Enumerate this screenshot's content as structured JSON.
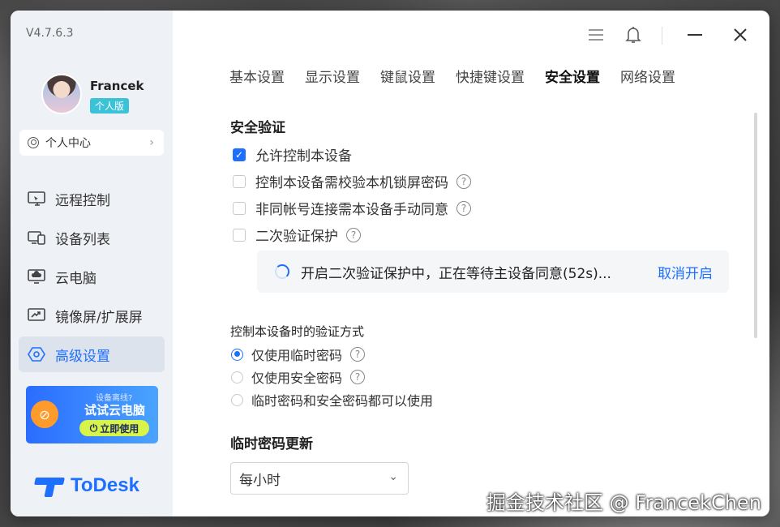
{
  "app": {
    "version": "V4.7.6.3",
    "brand_color": "#1f6fff",
    "logo_text": "ToDesk"
  },
  "user": {
    "name": "Francek",
    "edition": "个人版",
    "center_label": "个人中心"
  },
  "sidebar": {
    "items": [
      {
        "label": "远程控制",
        "icon": "remote-control-icon"
      },
      {
        "label": "设备列表",
        "icon": "device-list-icon"
      },
      {
        "label": "云电脑",
        "icon": "cloud-pc-icon"
      },
      {
        "label": "镜像屏/扩展屏",
        "icon": "mirror-screen-icon"
      },
      {
        "label": "高级设置",
        "icon": "advanced-settings-icon",
        "active": true
      }
    ]
  },
  "promo": {
    "small": "设备离线?",
    "big": "试试云电脑",
    "button": "立即使用"
  },
  "tabs": [
    {
      "label": "基本设置"
    },
    {
      "label": "显示设置"
    },
    {
      "label": "键鼠设置"
    },
    {
      "label": "快捷键设置"
    },
    {
      "label": "安全设置",
      "active": true
    },
    {
      "label": "网络设置"
    }
  ],
  "security": {
    "title": "安全验证",
    "options": [
      {
        "label": "允许控制本设备",
        "checked": true,
        "help": false
      },
      {
        "label": "控制本设备需校验本机锁屏密码",
        "checked": false,
        "help": true
      },
      {
        "label": "非同帐号连接需本设备手动同意",
        "checked": false,
        "help": true
      },
      {
        "label": "二次验证保护",
        "checked": false,
        "help": true
      }
    ],
    "notice_text": "开启二次验证保护中，正在等待主设备同意(52s)...",
    "notice_action": "取消开启"
  },
  "verify_method": {
    "title": "控制本设备时的验证方式",
    "options": [
      {
        "label": "仅使用临时密码",
        "checked": true,
        "help": true
      },
      {
        "label": "仅使用安全密码",
        "checked": false,
        "help": true
      },
      {
        "label": "临时密码和安全密码都可以使用",
        "checked": false,
        "help": false
      }
    ]
  },
  "temp_password": {
    "title": "临时密码更新",
    "selected": "每小时"
  },
  "watermark": "掘金技术社区 @ FrancekChen"
}
